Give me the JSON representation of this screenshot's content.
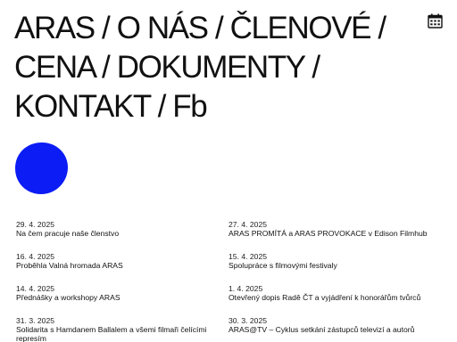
{
  "nav": {
    "items": [
      "ARAS",
      "O NÁS",
      "ČLENOVÉ",
      "CENA",
      "DOKUMENTY",
      "KONTAKT",
      "Fb"
    ],
    "separator": "/"
  },
  "icons": {
    "calendar": "calendar-icon",
    "blob": "blue-circle-logo"
  },
  "colors": {
    "accent": "#0b1cf5",
    "text": "#111111",
    "background": "#ffffff"
  },
  "news": [
    {
      "date": "29. 4. 2025",
      "title": "Na čem pracuje naše členstvo"
    },
    {
      "date": "27. 4. 2025",
      "title": "ARAS PROMÍTÁ a ARAS PROVOKACE v Edison Filmhub"
    },
    {
      "date": "16. 4. 2025",
      "title": "Proběhla Valná hromada ARAS"
    },
    {
      "date": "15. 4. 2025",
      "title": "Spolupráce s filmovými festivaly"
    },
    {
      "date": "14. 4. 2025",
      "title": "Přednášky a workshopy ARAS"
    },
    {
      "date": "1. 4. 2025",
      "title": "Otevřený dopis Radě ČT a vyjádření k honorářům tvůrců"
    },
    {
      "date": "31. 3. 2025",
      "title": "Solidarita s Hamdanem Ballalem a všemi filmaři čelícími represím"
    },
    {
      "date": "30. 3. 2025",
      "title": "ARAS@TV – Cyklus setkání zástupců televizí a autorů"
    }
  ]
}
